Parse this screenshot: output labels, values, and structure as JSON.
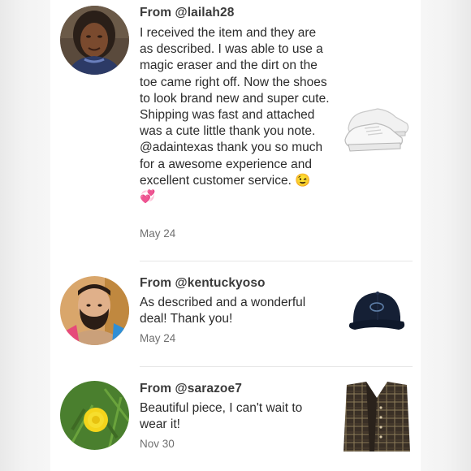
{
  "reviews": [
    {
      "from": "From @lailah28",
      "text": "I received the item and they are as described. I was able to use a magic eraser and the dirt on the toe came right off. Now the shoes to look brand new and super cute. Shipping was fast and attached was a cute little thank you note. @adaintexas thank you so much for a awesome experience and excellent customer service.",
      "emoji_wink": "😉",
      "emoji_heart": "💞",
      "date": "May 24",
      "avatar_icon": "woman-portrait",
      "thumb_icon": "white-sneakers"
    },
    {
      "from": "From @kentuckyoso",
      "text": "As described and a wonderful deal! Thank you!",
      "date": "May 24",
      "avatar_icon": "bearded-man-portrait",
      "thumb_icon": "navy-baseball-cap"
    },
    {
      "from": "From @sarazoe7",
      "text": "Beautiful piece, I can't wait to wear it!",
      "date": "Nov 30",
      "avatar_icon": "dandelion-flower",
      "thumb_icon": "plaid-jacket"
    }
  ],
  "colors": {
    "text": "#2b2b2b",
    "muted": "#6f6f6f",
    "divider": "#e6e6e6"
  }
}
